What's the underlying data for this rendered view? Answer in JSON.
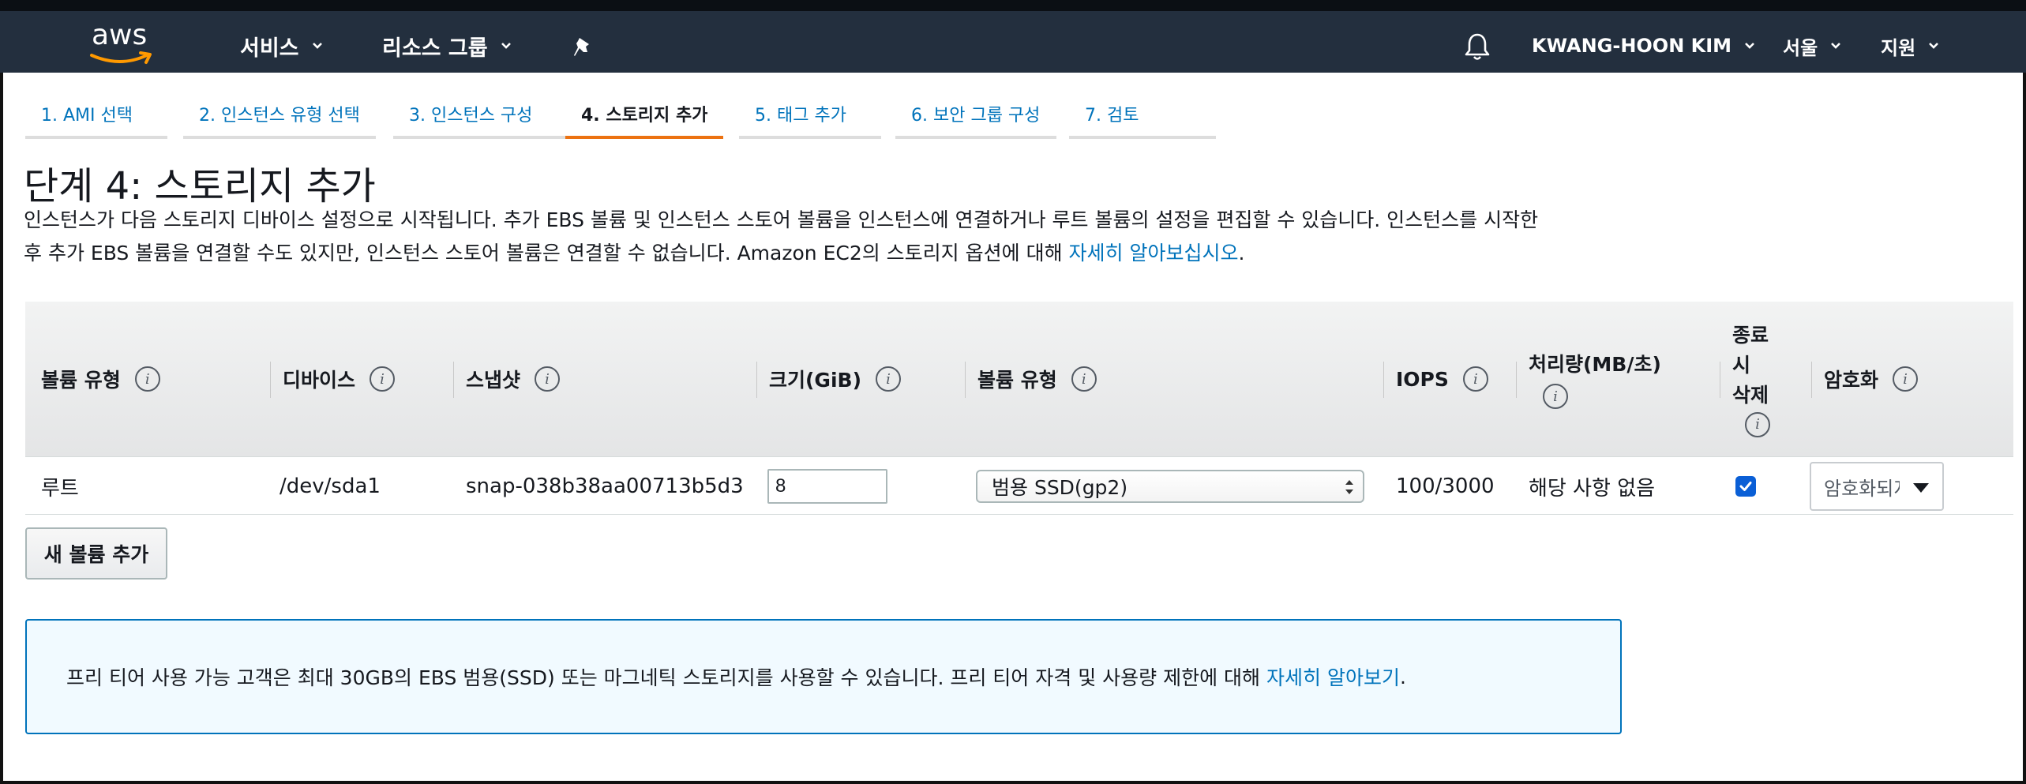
{
  "nav": {
    "logo_text": "aws",
    "services": "서비스",
    "resource_groups": "리소스 그룹",
    "user": "KWANG-HOON KIM",
    "region": "서울",
    "support": "지원"
  },
  "tabs": [
    {
      "label": "1. AMI 선택",
      "active": false
    },
    {
      "label": "2. 인스턴스 유형 선택",
      "active": false
    },
    {
      "label": "3. 인스턴스 구성",
      "active": false
    },
    {
      "label": "4. 스토리지 추가",
      "active": true
    },
    {
      "label": "5. 태그 추가",
      "active": false
    },
    {
      "label": "6. 보안 그룹 구성",
      "active": false
    },
    {
      "label": "7. 검토",
      "active": false
    }
  ],
  "page": {
    "title": "단계 4: 스토리지 추가",
    "description_line1": "인스턴스가 다음 스토리지 디바이스 설정으로 시작됩니다. 추가 EBS 볼륨 및 인스턴스 스토어 볼륨을 인스턴스에 연결하거나 루트 볼륨의 설정을 편집할 수 있습니다. 인스턴스를 시작한",
    "description_line2": "후 추가 EBS 볼륨을 연결할 수도 있지만, 인스턴스 스토어 볼륨은 연결할 수 없습니다. Amazon EC2의 스토리지 옵션에 대해 ",
    "description_link": "자세히 알아보십시오",
    "description_end": "."
  },
  "table": {
    "headers": {
      "volume_type": "볼륨 유형",
      "device": "디바이스",
      "snapshot": "스냅샷",
      "size": "크기(GiB)",
      "ebs_type": "볼륨 유형",
      "iops": "IOPS",
      "throughput_l1": "처리량(MB/초)",
      "delete_l1": "종료",
      "delete_l2": "시",
      "delete_l3": "삭제",
      "encryption": "암호화",
      "info": "i"
    },
    "row": {
      "volume_type": "루트",
      "device": "/dev/sda1",
      "snapshot": "snap-038b38aa00713b5d3",
      "size": "8",
      "ebs_type": "범용 SSD(gp2)",
      "iops": "100/3000",
      "throughput": "해당 사항 없음",
      "delete_on_termination": true,
      "encryption": "암호화되지 않음"
    }
  },
  "add_volume_button": "새 볼륨 추가",
  "notice": {
    "text": "프리 티어 사용 가능 고객은 최대 30GB의 EBS 범용(SSD) 또는 마그네틱 스토리지를 사용할 수 있습니다. 프리 티어 자격 및 사용량 제한에 대해",
    "link": "자세히 알아보기",
    "end": "."
  },
  "colors": {
    "nav_bg": "#232f3e",
    "link": "#0073bb",
    "active_tab": "#ec7211",
    "checkbox": "#0a5fd6",
    "notice_bg": "#f1faff"
  }
}
